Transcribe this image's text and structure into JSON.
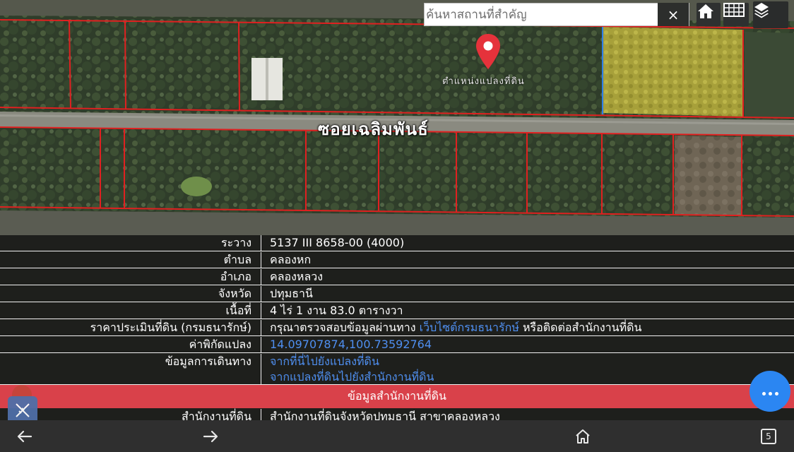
{
  "map": {
    "search_placeholder": "ค้นหาสถานที่สำคัญ",
    "clear_label": "×",
    "road_label": "ซอยเฉลิมพันธ์",
    "pin_caption": "ตำแหน่งแปลงที่ดิน",
    "icons": [
      "close-icon",
      "home-icon",
      "grid-icon",
      "layers-icon",
      "map-pin-icon"
    ]
  },
  "parcel_info": {
    "rows": [
      {
        "label": "ระวาง",
        "value": "5137 III 8658-00 (4000)"
      },
      {
        "label": "ตำบล",
        "value": "คลองหก"
      },
      {
        "label": "อำเภอ",
        "value": "คลองหลวง"
      },
      {
        "label": "จังหวัด",
        "value": "ปทุมธานี"
      },
      {
        "label": "เนื้อที่",
        "value": "4 ไร่ 1 งาน 83.0 ตารางวา"
      }
    ],
    "price": {
      "label": "ราคาประเมินที่ดิน (กรมธนารักษ์)",
      "text_before": "กรุณาตรวจสอบข้อมูลผ่านทาง ",
      "link": "เว็บไซต์กรมธนารักษ์ ",
      "text_after": "หรือติดต่อสำนักงานที่ดิน"
    },
    "coordinates": {
      "label": "ค่าพิกัดแปลง",
      "value": "14.09707874,100.73592764"
    },
    "directions": {
      "label": "ข้อมูลการเดินทาง",
      "link_1": "จากที่นี่ไปยังแปลงที่ดิน",
      "link_2": "จากแปลงที่ดินไปยังสำนักงานที่ดิน"
    },
    "section_title": "ข้อมูลสำนักงานที่ดิน",
    "office": {
      "label": "สำนักงานที่ดิน",
      "value": "สำนักงานที่ดินจังหวัดปทุมธานี สาขาคลองหลวง"
    }
  },
  "nav": {
    "tab_count": "5",
    "icons": [
      "back-arrow-icon",
      "forward-arrow-icon",
      "home-icon",
      "tabs-icon"
    ]
  },
  "colors": {
    "parcel_border": "#e02020",
    "section_bar": "#d9414a",
    "link": "#4f8ff0",
    "fab": "#2b86f2",
    "pin": "#e5323b",
    "selected_parcel": "#b8b22a"
  }
}
